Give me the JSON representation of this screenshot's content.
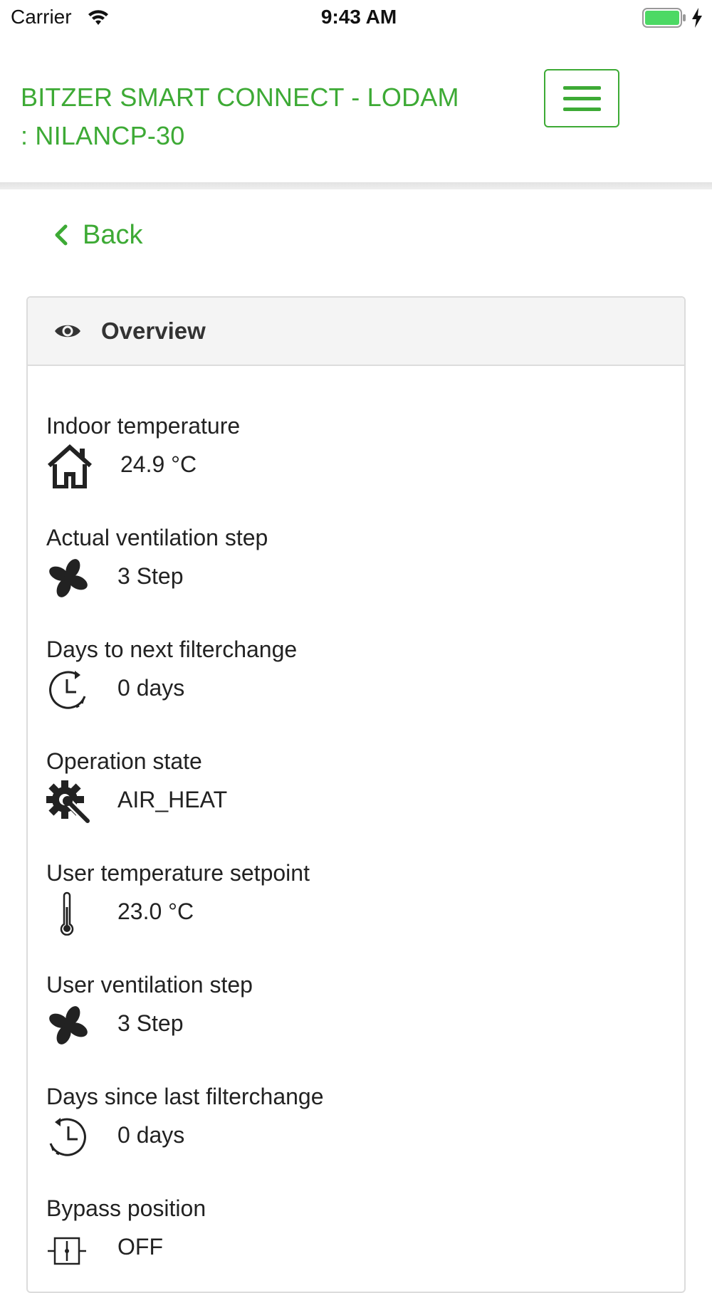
{
  "status_bar": {
    "carrier": "Carrier",
    "time": "9:43 AM",
    "battery_color": "#4cd964"
  },
  "header": {
    "brand_line1": "BITZER SMART CONNECT - LODAM",
    "brand_line2": ": NILANCP-30",
    "accent_color": "#3daa35"
  },
  "back_link": {
    "label": "Back"
  },
  "panel": {
    "title": "Overview",
    "items": [
      {
        "label": "Indoor temperature",
        "value": "24.9 °C",
        "icon": "home-icon"
      },
      {
        "label": "Actual ventilation step",
        "value": "3 Step",
        "icon": "fan-icon"
      },
      {
        "label": "Days to next filterchange",
        "value": "0 days",
        "icon": "clock-forward-icon"
      },
      {
        "label": "Operation state",
        "value": "AIR_HEAT",
        "icon": "gear-wrench-icon"
      },
      {
        "label": "User temperature setpoint",
        "value": "23.0 °C",
        "icon": "thermometer-icon"
      },
      {
        "label": "User ventilation step",
        "value": "3 Step",
        "icon": "fan-icon"
      },
      {
        "label": "Days since last filterchange",
        "value": "0 days",
        "icon": "clock-history-icon"
      },
      {
        "label": "Bypass position",
        "value": "OFF",
        "icon": "bypass-valve-icon"
      }
    ]
  }
}
